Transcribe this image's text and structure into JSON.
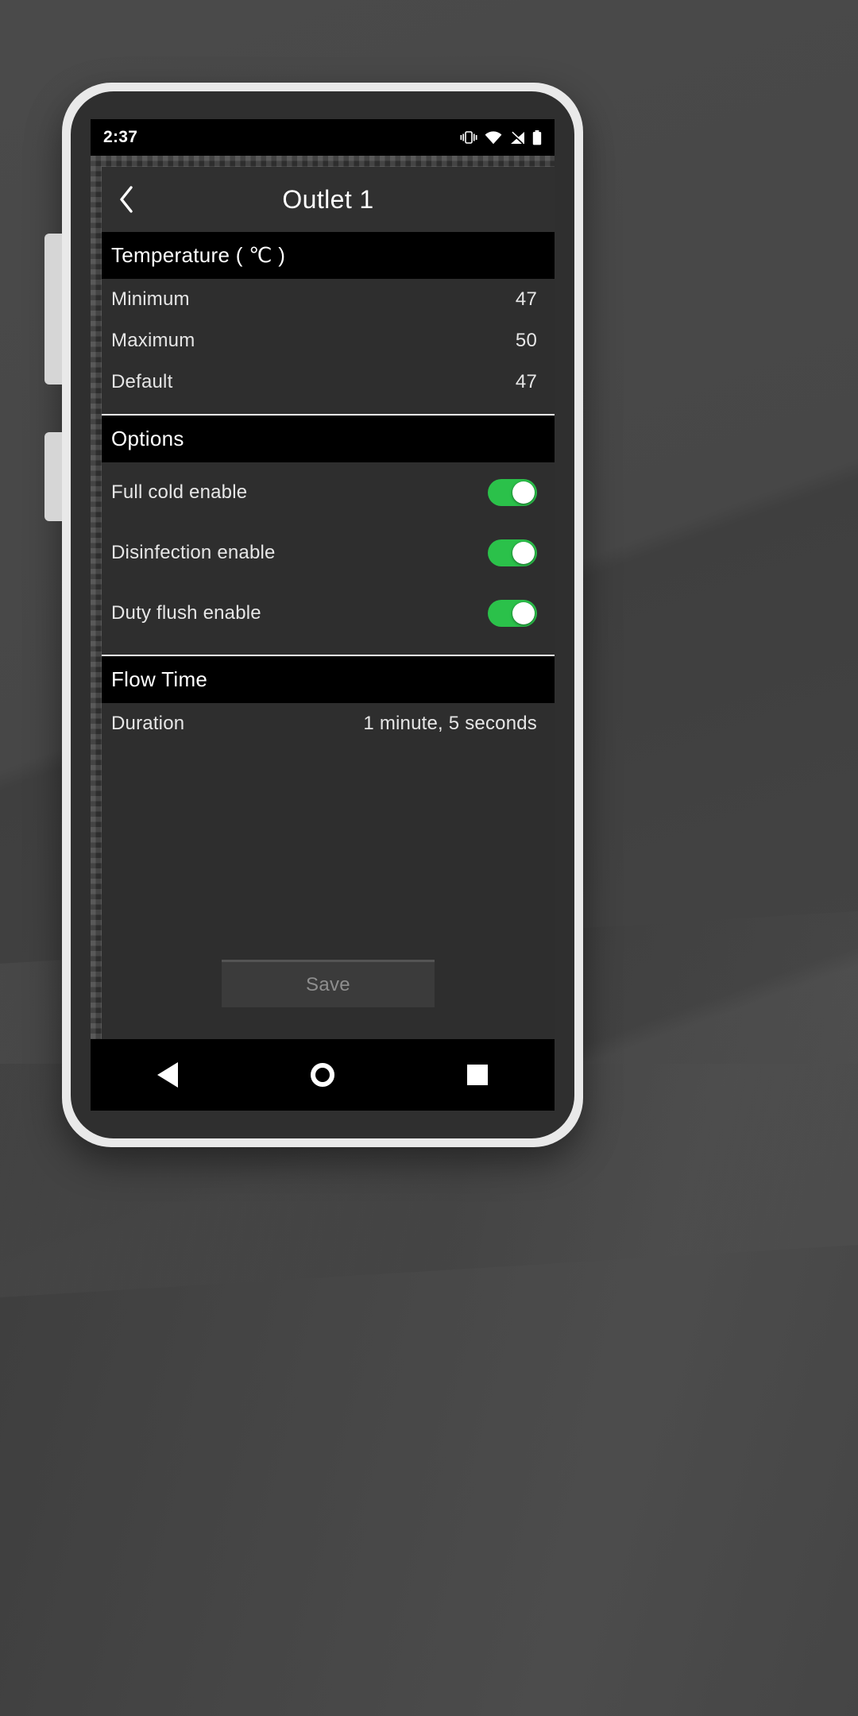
{
  "status_bar": {
    "time": "2:37",
    "icons": [
      "vibrate-icon",
      "wifi-icon",
      "cellular-signal-icon",
      "battery-icon"
    ]
  },
  "header": {
    "back_icon": "chevron-left-icon",
    "title": "Outlet 1"
  },
  "sections": [
    {
      "id": "temperature",
      "header": "Temperature ( ℃ )",
      "rows": [
        {
          "label": "Minimum",
          "value": "47"
        },
        {
          "label": "Maximum",
          "value": "50"
        },
        {
          "label": "Default",
          "value": "47"
        }
      ]
    },
    {
      "id": "options",
      "header": "Options",
      "rows": [
        {
          "label": "Full cold enable",
          "value": "on"
        },
        {
          "label": "Disinfection enable",
          "value": "on"
        },
        {
          "label": "Duty flush enable",
          "value": "on"
        }
      ]
    },
    {
      "id": "flow_time",
      "header": "Flow Time",
      "rows": [
        {
          "label": "Duration",
          "value": "1 minute, 5 seconds"
        }
      ]
    }
  ],
  "footer": {
    "save_label": "Save"
  },
  "nav_bar": {
    "back": "back-triangle-icon",
    "home": "home-circle-icon",
    "recents": "recents-square-icon"
  },
  "colors": {
    "toggle_on": "#2bc14a",
    "section_header_bg": "#000000",
    "content_bg": "#2e2e2e"
  }
}
